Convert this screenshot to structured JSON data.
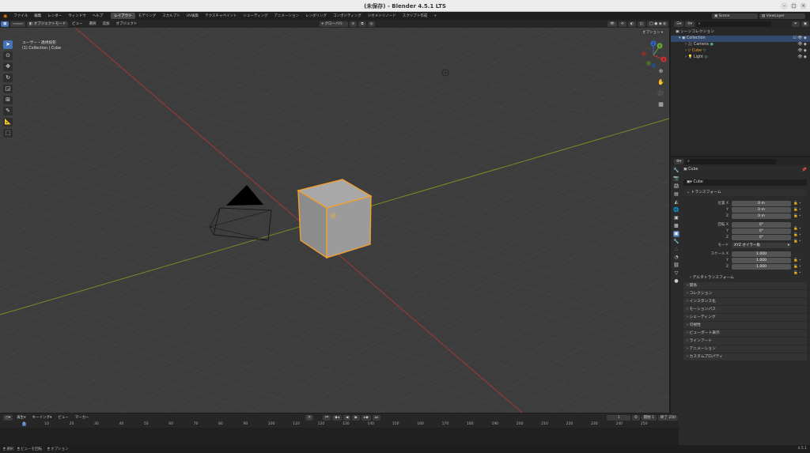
{
  "window": {
    "title": "(未保存) - Blender 4.5.1 LTS"
  },
  "menu": [
    "ファイル",
    "編集",
    "レンダー",
    "ウィンドウ",
    "ヘルプ"
  ],
  "workspaces": [
    "レイアウト",
    "モデリング",
    "スカルプト",
    "UV編集",
    "テクスチャペイント",
    "シェーディング",
    "アニメーション",
    "レンダリング",
    "コンポジティング",
    "ジオメトリノード",
    "スクリプト作成",
    "+"
  ],
  "scene": {
    "name": "Scene",
    "view_layer": "ViewLayer"
  },
  "viewport_header": {
    "mode": "オブジェクトモード",
    "menus": [
      "ビュー",
      "選択",
      "追加",
      "オブジェクト"
    ],
    "transform": "グローバル",
    "options": "オプション"
  },
  "viewport_overlay": {
    "line1": "ユーザー・透視投影",
    "line2": "(1) Collection | Cube"
  },
  "gizmo": {
    "x": "X",
    "y": "Y",
    "z": "Z"
  },
  "outliner": {
    "search_placeholder": "",
    "root": "シーンコレクション",
    "collection": "Collection",
    "items": [
      "Camera",
      "Cube",
      "Light"
    ]
  },
  "properties": {
    "object_name": "Cube",
    "object_field": "Cube",
    "transform_header": "トランスフォーム",
    "location_label": "位置 X",
    "rotation_label": "回転 X",
    "scale_label": "スケール X",
    "y_label": "Y",
    "z_label": "Z",
    "mode_label": "モード",
    "location": [
      "0 m",
      "0 m",
      "0 m"
    ],
    "rotation": [
      "0°",
      "0°",
      "0°"
    ],
    "scale": [
      "1.000",
      "1.000",
      "1.000"
    ],
    "rotation_mode": "XYZ オイラー角",
    "delta_transform": "デルタトランスフォーム",
    "sections": [
      "関係",
      "コレクション",
      "インスタンス化",
      "モーションパス",
      "シェーディング",
      "可視性",
      "ビューポート表示",
      "ラインアート",
      "アニメーション",
      "カスタムプロパティ"
    ]
  },
  "timeline": {
    "menus": [
      "再生",
      "キーイング",
      "ビュー",
      "マーカー"
    ],
    "current_frame": "1",
    "start_label": "開始",
    "start": "1",
    "end_label": "終了",
    "end": "250",
    "ticks": [
      "1",
      "10",
      "20",
      "30",
      "40",
      "50",
      "60",
      "70",
      "80",
      "90",
      "100",
      "110",
      "120",
      "130",
      "140",
      "150",
      "160",
      "170",
      "180",
      "190",
      "200",
      "210",
      "220",
      "230",
      "240",
      "250"
    ]
  },
  "statusbar": {
    "select": "選択",
    "rotate": "ビューを回転",
    "options": "オプション",
    "version": "4.5.1"
  },
  "colors": {
    "accent": "#4772b3",
    "selected": "#f0a030",
    "x_axis": "#b03030",
    "y_axis": "#7a8a20"
  }
}
